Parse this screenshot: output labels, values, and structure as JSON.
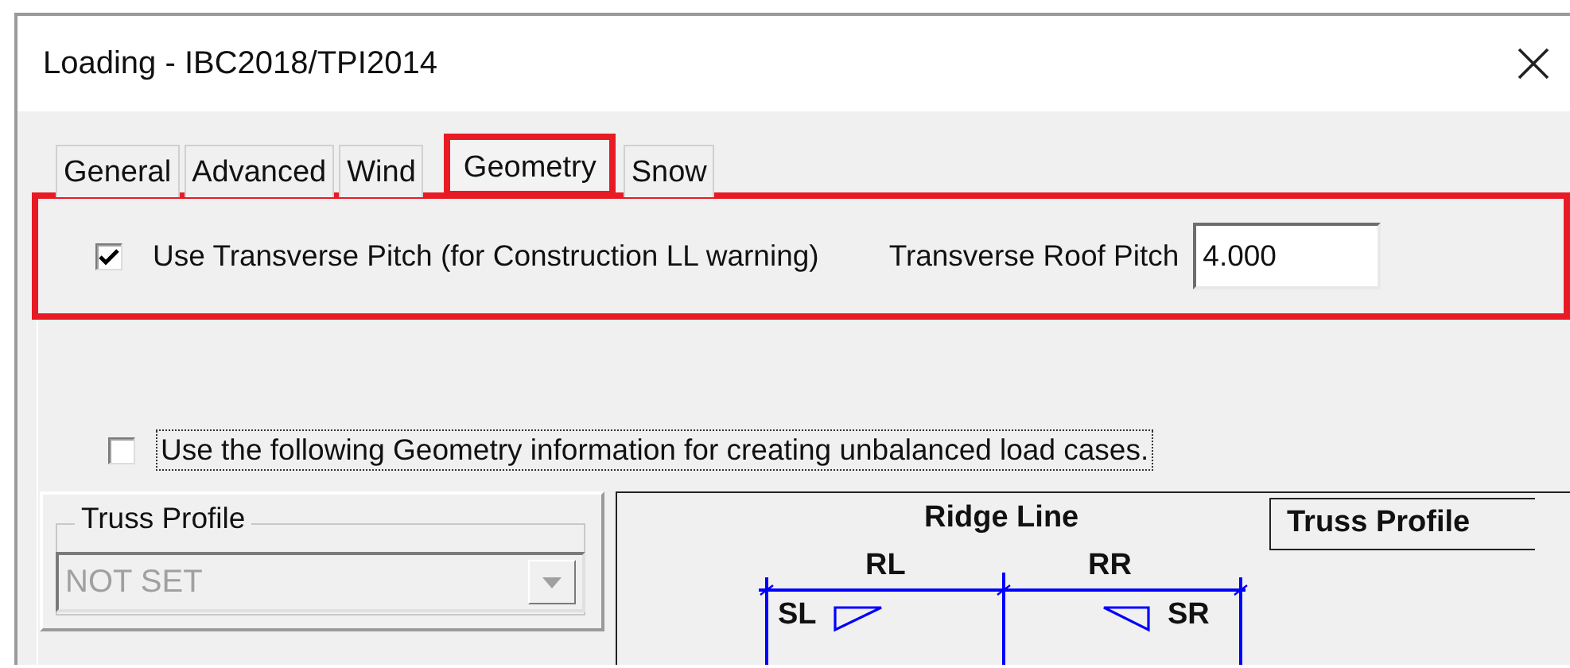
{
  "window": {
    "title": "Loading - IBC2018/TPI2014"
  },
  "tabs": [
    {
      "label": "General",
      "selected": false,
      "highlighted": false
    },
    {
      "label": "Advanced",
      "selected": false,
      "highlighted": false
    },
    {
      "label": "Wind",
      "selected": false,
      "highlighted": false
    },
    {
      "label": "Geometry",
      "selected": true,
      "highlighted": true
    },
    {
      "label": "Snow",
      "selected": false,
      "highlighted": false
    }
  ],
  "transverse": {
    "highlighted": true,
    "checked": true,
    "label": "Use Transverse Pitch (for Construction LL warning)",
    "pitch_label": "Transverse Roof Pitch",
    "pitch_value": "4.000"
  },
  "unbalanced": {
    "checked": false,
    "focused": true,
    "label": "Use the following Geometry information for creating unbalanced load cases."
  },
  "truss_profile": {
    "title": "Truss Profile",
    "value": "NOT SET",
    "disabled": true
  },
  "diagram": {
    "title": "Ridge Line",
    "legend": "Truss Profile",
    "left_span": "RL",
    "right_span": "RR",
    "left_slope": "SL",
    "right_slope": "SR"
  }
}
